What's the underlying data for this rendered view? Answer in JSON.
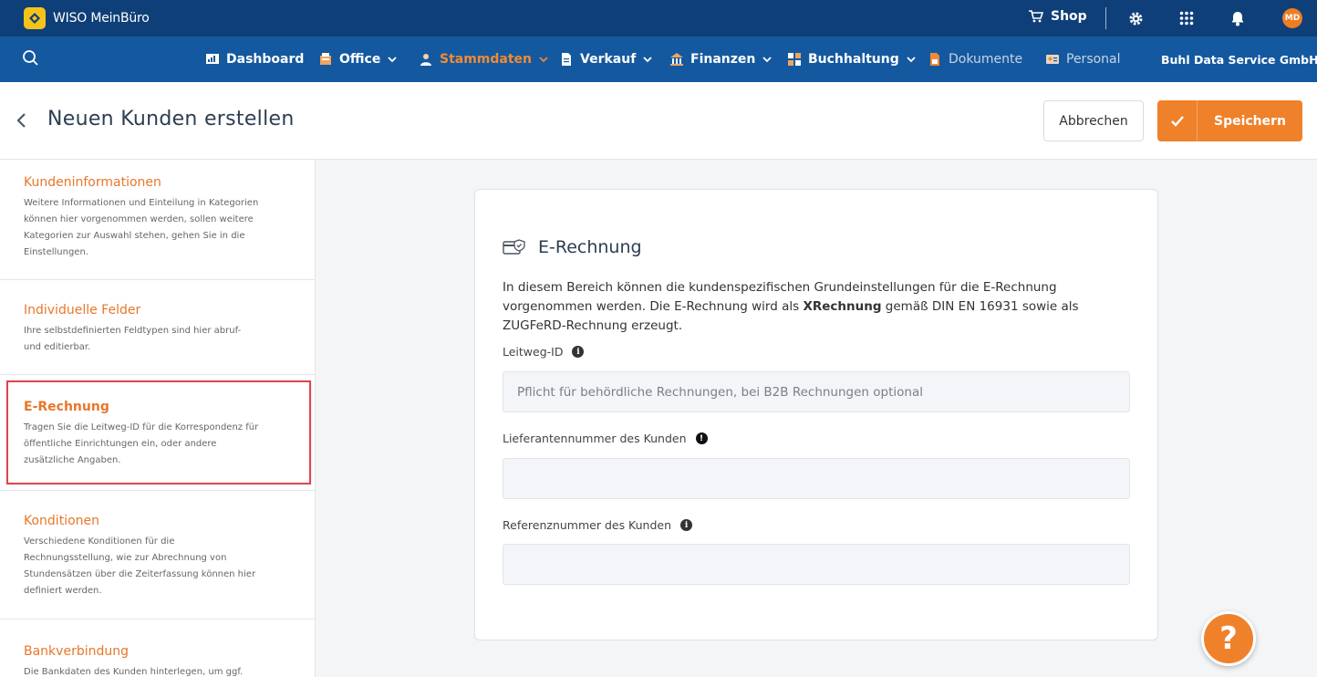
{
  "app": {
    "name": "WISO MeinBüro"
  },
  "topbar": {
    "shop_label": "Shop",
    "avatar_initials": "MD"
  },
  "nav": {
    "items": [
      {
        "label": "Dashboard"
      },
      {
        "label": "Office"
      },
      {
        "label": "Stammdaten"
      },
      {
        "label": "Verkauf"
      },
      {
        "label": "Finanzen"
      },
      {
        "label": "Buchhaltung"
      },
      {
        "label": "Dokumente"
      },
      {
        "label": "Personal"
      }
    ],
    "company": "Buhl Data Service GmbH",
    "active_color": "#f08a36"
  },
  "header": {
    "title": "Neuen Kunden erstellen",
    "cancel_label": "Abbrechen",
    "save_label": "Speichern"
  },
  "sidebar": {
    "sections": [
      {
        "title": "Kundeninformationen",
        "desc": "Weitere Informationen und Einteilung in Kategorien können hier vorgenommen werden, sollen weitere Kategorien zur Auswahl stehen, gehen Sie in die Einstellungen."
      },
      {
        "title": "Individuelle Felder",
        "desc": "Ihre selbstdefinierten Feldtypen sind hier abruf- und editierbar."
      },
      {
        "title": "E-Rechnung",
        "desc": "Tragen Sie die Leitweg-ID für die Korrespondenz für öffentliche Einrichtungen ein, oder andere zusätzliche Angaben."
      },
      {
        "title": "Konditionen",
        "desc": "Verschiedene Konditionen für die Rechnungsstellung, wie zur Abrechnung von Stundensätzen über die Zeiterfassung können hier definiert werden."
      },
      {
        "title": "Bankverbindung",
        "desc": "Die Bankdaten des Kunden hinterlegen, um ggf."
      }
    ]
  },
  "card": {
    "title": "E-Rechnung",
    "intro_before": "In diesem Bereich können die kundenspezifischen Grundeinstellungen für die E-Rechnung vorgenommen werden. Die E-Rechnung wird als ",
    "intro_bold": "XRechnung",
    "intro_after": " gemäß DIN EN 16931 sowie als ZUGFeRD-Rechnung erzeugt.",
    "fields": [
      {
        "label": "Leitweg-ID",
        "value": "",
        "placeholder": "Pflicht für behördliche Rechnungen, bei B2B Rechnungen optional"
      },
      {
        "label": "Lieferantennummer des Kunden",
        "value": "",
        "placeholder": ""
      },
      {
        "label": "Referenznummer des Kunden",
        "value": "",
        "placeholder": ""
      }
    ]
  },
  "help": {
    "label": "?"
  },
  "colors": {
    "topbar": "#0f3f78",
    "navbar": "#14599f",
    "accent": "#f0812b",
    "highlight_border": "#e0454f"
  }
}
